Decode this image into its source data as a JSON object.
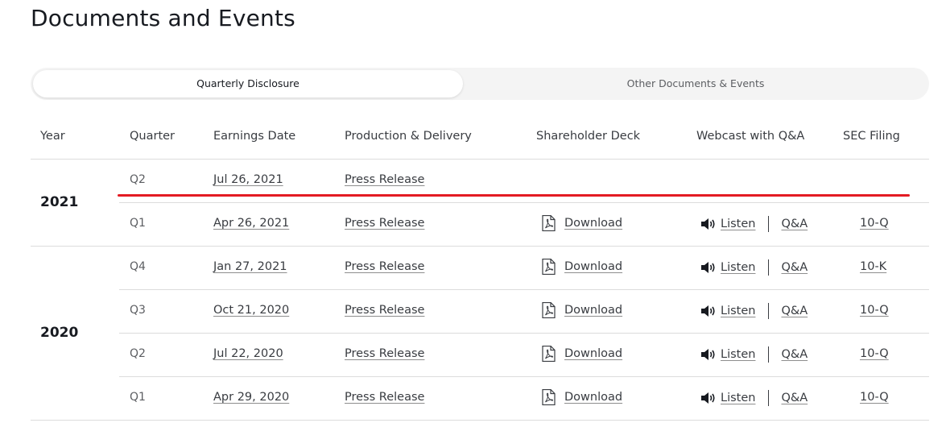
{
  "page": {
    "title": "Documents and Events"
  },
  "tabs": [
    {
      "label": "Quarterly Disclosure",
      "active": true
    },
    {
      "label": "Other Documents & Events",
      "active": false
    }
  ],
  "table": {
    "columns": [
      "Year",
      "Quarter",
      "Earnings Date",
      "Production & Delivery",
      "Shareholder Deck",
      "Webcast with Q&A",
      "SEC Filing"
    ],
    "years": [
      {
        "year": "2021",
        "rows": [
          {
            "quarter": "Q2",
            "earnings_date": "Jul 26, 2021",
            "production": "Press Release",
            "deck": "",
            "listen": "",
            "qa": "",
            "sec": ""
          },
          {
            "quarter": "Q1",
            "earnings_date": "Apr 26, 2021",
            "production": "Press Release",
            "deck": "Download",
            "listen": "Listen",
            "qa": "Q&A",
            "sec": "10-Q"
          }
        ]
      },
      {
        "year": "2020",
        "rows": [
          {
            "quarter": "Q4",
            "earnings_date": "Jan 27, 2021",
            "production": "Press Release",
            "deck": "Download",
            "listen": "Listen",
            "qa": "Q&A",
            "sec": "10-K"
          },
          {
            "quarter": "Q3",
            "earnings_date": "Oct 21, 2020",
            "production": "Press Release",
            "deck": "Download",
            "listen": "Listen",
            "qa": "Q&A",
            "sec": "10-Q"
          },
          {
            "quarter": "Q2",
            "earnings_date": "Jul 22, 2020",
            "production": "Press Release",
            "deck": "Download",
            "listen": "Listen",
            "qa": "Q&A",
            "sec": "10-Q"
          },
          {
            "quarter": "Q1",
            "earnings_date": "Apr 29, 2020",
            "production": "Press Release",
            "deck": "Download",
            "listen": "Listen",
            "qa": "Q&A",
            "sec": "10-Q"
          }
        ]
      }
    ]
  },
  "icons": {
    "deck": "pdf-icon",
    "webcast": "speaker-icon"
  },
  "colors": {
    "highlight_line": "#e31b23",
    "text": "#393c41",
    "tab_bg": "#f4f4f4"
  }
}
